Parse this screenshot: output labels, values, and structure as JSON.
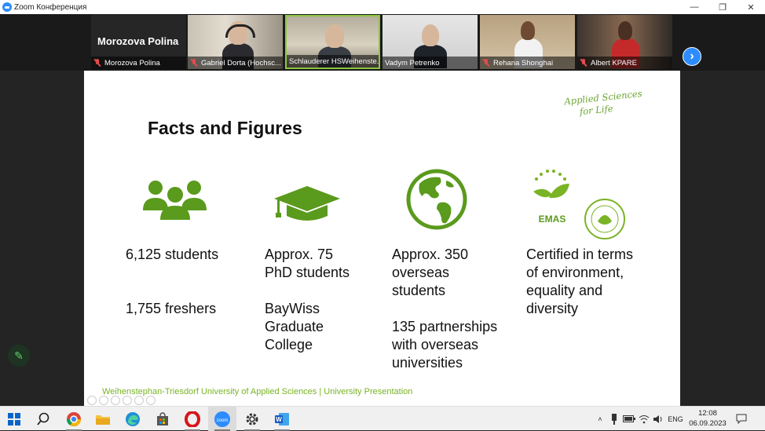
{
  "window": {
    "title": "Zoom Конференция"
  },
  "participants": [
    {
      "name": "Morozova Polina",
      "display_name": "Morozova Polina",
      "video": false
    },
    {
      "name": "Gabriel Dorta (Hochsc..."
    },
    {
      "name": "Schlauderer HSWeihenste...",
      "active": true
    },
    {
      "name": "Vadym Petrenko"
    },
    {
      "name": "Rehana Shonghai"
    },
    {
      "name": "Albert KPARE"
    }
  ],
  "slide": {
    "title": "Facts and Figures",
    "tagline_line1": "Applied Sciences",
    "tagline_line2": "for Life",
    "columns": [
      {
        "icon": "people-group-icon",
        "lines": [
          "6,125 students",
          "",
          "",
          "1,755 freshers"
        ]
      },
      {
        "icon": "graduation-cap-icon",
        "lines": [
          "Approx. 75",
          "PhD students",
          "",
          "BayWiss",
          "Graduate",
          "College"
        ]
      },
      {
        "icon": "globe-icon",
        "lines": [
          "Approx. 350",
          "overseas",
          "students",
          "",
          "135 partnerships",
          "with overseas",
          "universities"
        ]
      },
      {
        "icon": "certification-logos-icon",
        "lines": [
          "Certified in terms",
          "of environment,",
          "equality and",
          "diversity"
        ],
        "emas_label": "EMAS"
      }
    ],
    "footer": "Weihenstephan-Triesdorf University of Applied Sciences | University Presentation",
    "brand_color": "#5a9a1c"
  },
  "taskbar": {
    "language": "ENG",
    "time": "12:08",
    "date": "06.09.2023"
  }
}
